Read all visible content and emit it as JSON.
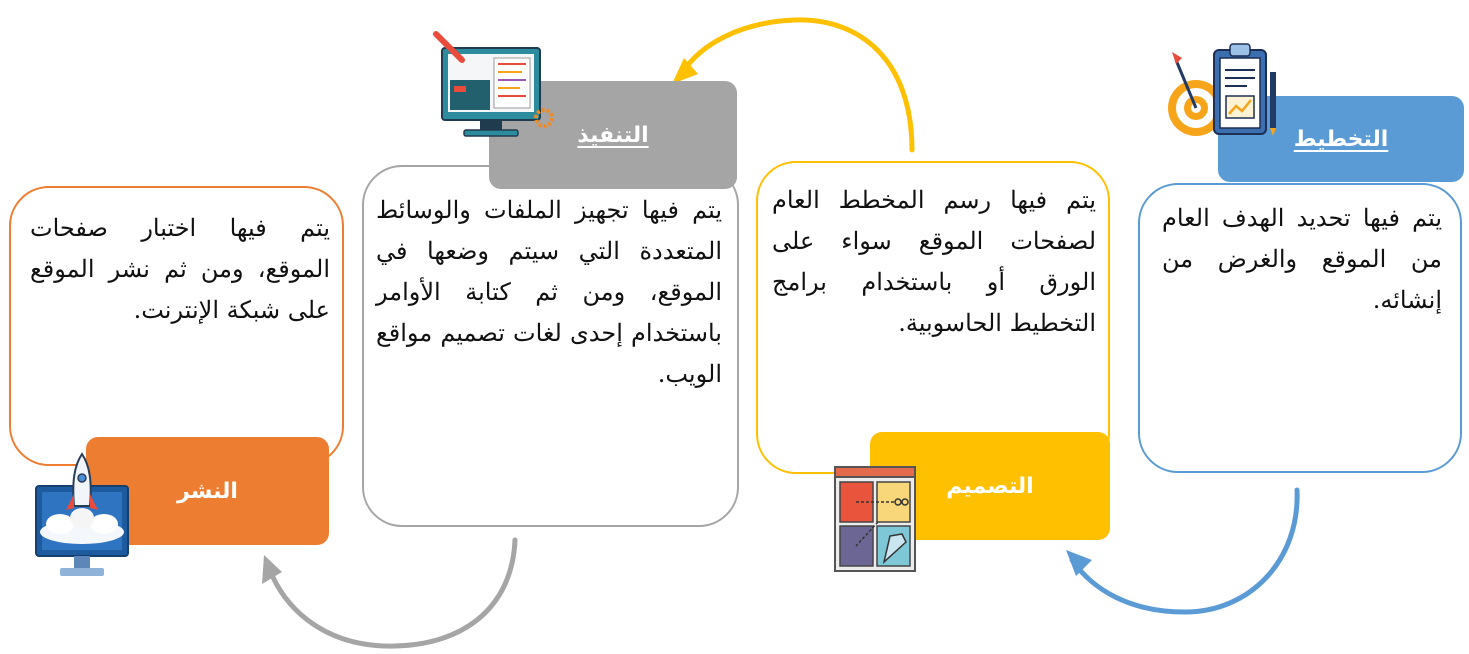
{
  "stages": {
    "planning": {
      "title": "التخطيط",
      "text": "يتم فيها تحديد الهدف العام من الموقع والغرض من إنشائه.",
      "color": "#5B9BD5"
    },
    "design": {
      "title": "التصميم",
      "text": "يتم فيها رسم المخطط العام لصفحات الموقع سواء على الورق أو باستخدام برامج التخطيط الحاسوبية.",
      "color": "#FFC000"
    },
    "implementation": {
      "title": "التنفيذ",
      "text": "يتم فيها تجهيز الملفات والوسائط المتعددة التي سيتم وضعها في الموقع، ومن ثم كتابة الأوامر باستخدام إحدى لغات تصميم مواقع الويب.",
      "color": "#A5A5A5"
    },
    "publishing": {
      "title": "النشر",
      "text": "يتم فيها اختبار صفحات الموقع، ومن ثم نشر الموقع على شبكة الإنترنت.",
      "color": "#ED7D31"
    }
  },
  "icons": [
    "planning-clipboard-target-icon",
    "design-board-icon",
    "implementation-code-monitor-icon",
    "publishing-rocket-monitor-icon"
  ],
  "arrow_colors": {
    "planning_to_design": "#5B9BD5",
    "design_to_implementation": "#FFC000",
    "implementation_to_publishing": "#A5A5A5"
  }
}
